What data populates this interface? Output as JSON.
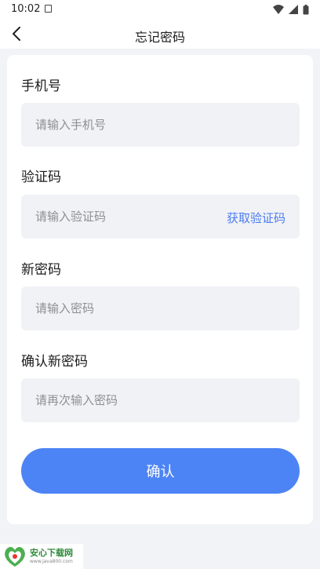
{
  "status_bar": {
    "time": "10:02"
  },
  "nav": {
    "title": "忘记密码"
  },
  "form": {
    "phone": {
      "label": "手机号",
      "placeholder": "请输入手机号"
    },
    "code": {
      "label": "验证码",
      "placeholder": "请输入验证码",
      "get_code_label": "获取验证码"
    },
    "new_password": {
      "label": "新密码",
      "placeholder": "请输入密码"
    },
    "confirm_password": {
      "label": "确认新密码",
      "placeholder": "请再次输入密码"
    },
    "submit_label": "确认"
  },
  "watermark": {
    "name": "安心下载网",
    "url": "www.java800.com"
  },
  "colors": {
    "accent": "#4d84f5",
    "link": "#4a7cf0",
    "field_bg": "#f1f2f6",
    "page_bg": "#f2f3f7"
  }
}
